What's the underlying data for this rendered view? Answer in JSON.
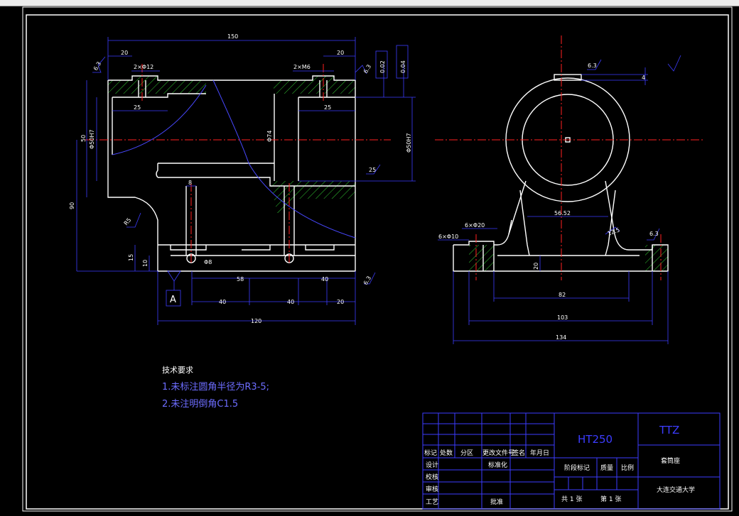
{
  "window": {
    "title_bar": ""
  },
  "colors": {
    "background": "#000000",
    "outline": "#ffffff",
    "centerline": "#ff2020",
    "dimension": "#3c3cff",
    "hatch": "#33cc33",
    "frame": "#ffffff"
  },
  "front_view": {
    "dims": {
      "overall_top": "150",
      "top_left": "20",
      "top_right": "20",
      "hole_left": "2×Φ12",
      "hole_right": "2×M6",
      "inner_left": "25",
      "inner_right": "25",
      "bore_left": "Φ50H7",
      "bore_center": "Φ74",
      "bore_right": "Φ50H7",
      "height_left": "90",
      "height_inner": "50",
      "base_left_a": "15",
      "base_left_b": "10",
      "slot_width": "8",
      "fillet": "R5",
      "hole_small": "Φ8",
      "bottom_58": "58",
      "bottom_40": "40",
      "bottom_40b": "40",
      "bottom_40c": "40",
      "bottom_20": "20",
      "overall_bottom": "120",
      "rough_a": "6.3",
      "rough_b": "6.3",
      "rough_c": "25",
      "rough_d": "6.3",
      "gtol_a": "0.02",
      "gtol_b": "0.04",
      "datum": "A"
    }
  },
  "side_view": {
    "dims": {
      "top_rough": "6.3",
      "top_small": "4",
      "slot": "6×Φ20",
      "holes": "6×Φ10",
      "web": "56.52",
      "base_h": "20",
      "inner": "82",
      "mid": "103",
      "overall": "134",
      "right_rough": "6.3",
      "corner_rough": "12.5"
    }
  },
  "tech_notes": {
    "heading": "技术要求",
    "line1": "1.未标注圆角半径为R3-5;",
    "line2": "2.未注明倒角C1.5"
  },
  "title_block": {
    "material": "HT250",
    "code": "TTZ",
    "part_name": "套筒座",
    "school": "大连交通大学",
    "row_labels": [
      "标记",
      "处数",
      "分区",
      "更改文件号",
      "签名",
      "年月日"
    ],
    "designer_label": "设计",
    "std_label": "标准化",
    "check_label": "校核",
    "review_label": "审核",
    "process_label": "工艺",
    "approve_label": "批准",
    "stage_label": "阶段标记",
    "weight_label": "质量",
    "scale_label": "比例",
    "sheet_total": "共 1 张",
    "sheet_no": "第 1 张"
  }
}
